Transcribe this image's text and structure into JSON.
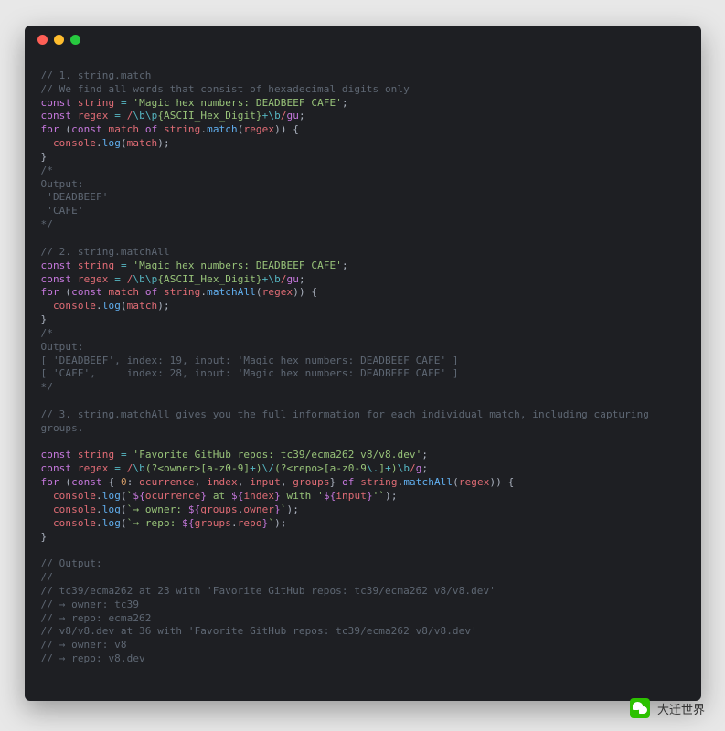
{
  "window": {
    "traffic_lights": [
      "red",
      "yellow",
      "green"
    ]
  },
  "code_lines": [
    {
      "cls": "",
      "html": ""
    },
    {
      "cls": "cmt",
      "html": "// 1. string.match"
    },
    {
      "cls": "cmt",
      "html": "// We find all words that consist of hexadecimal digits only"
    },
    {
      "cls": "",
      "html": "<span class='kw'>const</span> <span class='var'>string</span> <span class='op'>=</span> <span class='str'>'Magic hex numbers: DEADBEEF CAFE'</span><span class='pl'>;</span>"
    },
    {
      "cls": "",
      "html": "<span class='kw'>const</span> <span class='var'>regex</span> <span class='op'>=</span> <span class='rgx'>/</span><span class='rgxesc'>\\b</span><span class='rgxesc'>\\p</span><span class='rgxbody'>{ASCII_Hex_Digit}</span><span class='op'>+</span><span class='rgxesc'>\\b</span><span class='rgx'>/</span><span class='rgxflag'>gu</span><span class='pl'>;</span>"
    },
    {
      "cls": "",
      "html": "<span class='kw'>for</span> <span class='pl'>(</span><span class='kw'>const</span> <span class='var'>match</span> <span class='kw'>of</span> <span class='var'>string</span><span class='pl'>.</span><span class='fn'>match</span><span class='pl'>(</span><span class='var'>regex</span><span class='pl'>)) {</span>"
    },
    {
      "cls": "",
      "html": "  <span class='var'>console</span><span class='pl'>.</span><span class='fn'>log</span><span class='pl'>(</span><span class='var'>match</span><span class='pl'>);</span>"
    },
    {
      "cls": "pl",
      "html": "}"
    },
    {
      "cls": "cmt",
      "html": "/*"
    },
    {
      "cls": "cmt",
      "html": "Output:"
    },
    {
      "cls": "cmt",
      "html": " 'DEADBEEF'"
    },
    {
      "cls": "cmt",
      "html": " 'CAFE'"
    },
    {
      "cls": "cmt",
      "html": "*/"
    },
    {
      "cls": "",
      "html": ""
    },
    {
      "cls": "cmt",
      "html": "// 2. string.matchAll"
    },
    {
      "cls": "",
      "html": "<span class='kw'>const</span> <span class='var'>string</span> <span class='op'>=</span> <span class='str'>'Magic hex numbers: DEADBEEF CAFE'</span><span class='pl'>;</span>"
    },
    {
      "cls": "",
      "html": "<span class='kw'>const</span> <span class='var'>regex</span> <span class='op'>=</span> <span class='rgx'>/</span><span class='rgxesc'>\\b</span><span class='rgxesc'>\\p</span><span class='rgxbody'>{ASCII_Hex_Digit}</span><span class='op'>+</span><span class='rgxesc'>\\b</span><span class='rgx'>/</span><span class='rgxflag'>gu</span><span class='pl'>;</span>"
    },
    {
      "cls": "",
      "html": "<span class='kw'>for</span> <span class='pl'>(</span><span class='kw'>const</span> <span class='var'>match</span> <span class='kw'>of</span> <span class='var'>string</span><span class='pl'>.</span><span class='fn'>matchAll</span><span class='pl'>(</span><span class='var'>regex</span><span class='pl'>)) {</span>"
    },
    {
      "cls": "",
      "html": "  <span class='var'>console</span><span class='pl'>.</span><span class='fn'>log</span><span class='pl'>(</span><span class='var'>match</span><span class='pl'>);</span>"
    },
    {
      "cls": "pl",
      "html": "}"
    },
    {
      "cls": "cmt",
      "html": "/*"
    },
    {
      "cls": "cmt",
      "html": "Output:"
    },
    {
      "cls": "cmt",
      "html": "[ 'DEADBEEF', index: 19, input: 'Magic hex numbers: DEADBEEF CAFE' ]"
    },
    {
      "cls": "cmt",
      "html": "[ 'CAFE',     index: 28, input: 'Magic hex numbers: DEADBEEF CAFE' ]"
    },
    {
      "cls": "cmt",
      "html": "*/"
    },
    {
      "cls": "",
      "html": ""
    },
    {
      "cls": "cmt",
      "html": "// 3. string.matchAll gives you the full information for each individual match, including capturing"
    },
    {
      "cls": "cmt",
      "html": "groups."
    },
    {
      "cls": "",
      "html": ""
    },
    {
      "cls": "",
      "html": "<span class='kw'>const</span> <span class='var'>string</span> <span class='op'>=</span> <span class='str'>'Favorite GitHub repos: tc39/ecma262 v8/v8.dev'</span><span class='pl'>;</span>"
    },
    {
      "cls": "",
      "html": "<span class='kw'>const</span> <span class='var'>regex</span> <span class='op'>=</span> <span class='rgx'>/</span><span class='rgxesc'>\\b</span><span class='rgxbody'>(?&lt;owner&gt;[a-z0-9]</span><span class='op'>+</span><span class='rgxbody'>)</span><span class='rgxesc'>\\/</span><span class='rgxbody'>(?&lt;repo&gt;[a-z0-9</span><span class='rgxesc'>\\.</span><span class='rgxbody'>]</span><span class='op'>+</span><span class='rgxbody'>)</span><span class='rgxesc'>\\b</span><span class='rgx'>/</span><span class='rgxflag'>g</span><span class='pl'>;</span>"
    },
    {
      "cls": "",
      "html": "<span class='kw'>for</span> <span class='pl'>(</span><span class='kw'>const</span> <span class='pl'>{ </span><span class='num'>0</span><span class='pl'>: </span><span class='var'>ocurrence</span><span class='pl'>, </span><span class='var'>index</span><span class='pl'>, </span><span class='var'>input</span><span class='pl'>, </span><span class='var'>groups</span><span class='pl'>} </span><span class='kw'>of</span> <span class='var'>string</span><span class='pl'>.</span><span class='fn'>matchAll</span><span class='pl'>(</span><span class='var'>regex</span><span class='pl'>)) {</span>"
    },
    {
      "cls": "",
      "html": "  <span class='var'>console</span><span class='pl'>.</span><span class='fn'>log</span><span class='pl'>(</span><span class='tmpl'>`</span><span class='kw'>${</span><span class='sub'>ocurrence</span><span class='kw'>}</span><span class='tmpl'> at </span><span class='kw'>${</span><span class='sub'>index</span><span class='kw'>}</span><span class='tmpl'> with '</span><span class='kw'>${</span><span class='sub'>input</span><span class='kw'>}</span><span class='tmpl'>'`</span><span class='pl'>);</span>"
    },
    {
      "cls": "",
      "html": "  <span class='var'>console</span><span class='pl'>.</span><span class='fn'>log</span><span class='pl'>(</span><span class='tmpl'>`→ owner: </span><span class='kw'>${</span><span class='sub'>groups</span><span class='pl'>.</span><span class='sub'>owner</span><span class='kw'>}</span><span class='tmpl'>`</span><span class='pl'>);</span>"
    },
    {
      "cls": "",
      "html": "  <span class='var'>console</span><span class='pl'>.</span><span class='fn'>log</span><span class='pl'>(</span><span class='tmpl'>`→ repo: </span><span class='kw'>${</span><span class='sub'>groups</span><span class='pl'>.</span><span class='sub'>repo</span><span class='kw'>}</span><span class='tmpl'>`</span><span class='pl'>);</span>"
    },
    {
      "cls": "pl",
      "html": "}"
    },
    {
      "cls": "",
      "html": ""
    },
    {
      "cls": "cmt",
      "html": "// Output:"
    },
    {
      "cls": "cmt",
      "html": "//"
    },
    {
      "cls": "cmt",
      "html": "// tc39/ecma262 at 23 with 'Favorite GitHub repos: tc39/ecma262 v8/v8.dev'"
    },
    {
      "cls": "cmt",
      "html": "// → owner: tc39"
    },
    {
      "cls": "cmt",
      "html": "// → repo: ecma262"
    },
    {
      "cls": "cmt",
      "html": "// v8/v8.dev at 36 with 'Favorite GitHub repos: tc39/ecma262 v8/v8.dev'"
    },
    {
      "cls": "cmt",
      "html": "// → owner: v8"
    },
    {
      "cls": "cmt",
      "html": "// → repo: v8.dev"
    }
  ],
  "footer": {
    "label": "大迁世界"
  }
}
